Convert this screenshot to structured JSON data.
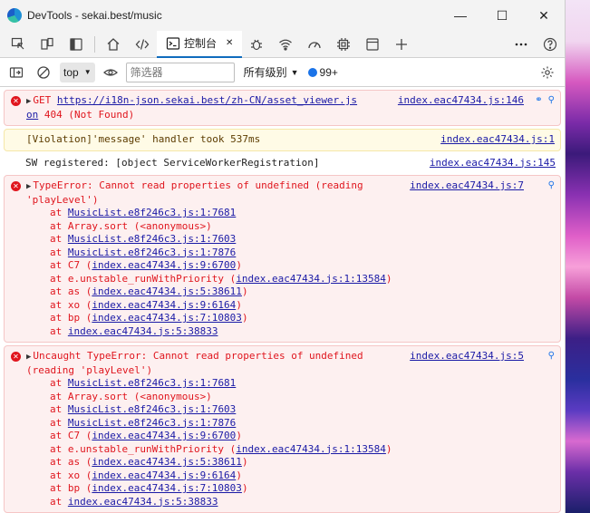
{
  "window": {
    "title": "DevTools - sekai.best/music"
  },
  "toolbar": {
    "console_tab_label": "控制台"
  },
  "filter": {
    "context": "top",
    "placeholder": "筛选器",
    "levels_label": "所有级别",
    "issues_count": "99+"
  },
  "messages": {
    "m1": {
      "text_prefix": "GET ",
      "url": "https://i18n-json.sekai.best/zh-CN/asset_viewer.js",
      "url2": "on",
      "status": " 404 (Not Found)",
      "source": "index.eac47434.js:146"
    },
    "m2": {
      "text": "[Violation]'message' handler took 537ms",
      "source": "index.eac47434.js:1"
    },
    "m3": {
      "text": "SW registered: [object ServiceWorkerRegistration]",
      "source": "index.eac47434.js:145"
    },
    "m4": {
      "text1": "TypeError: Cannot read properties of undefined (reading",
      "text2": "'playLevel')",
      "source": "index.eac47434.js:7"
    },
    "m5": {
      "text1": "Uncaught TypeError: Cannot read properties of undefined",
      "text2": "(reading 'playLevel')",
      "source": "index.eac47434.js:5"
    },
    "frames": [
      {
        "prefix": "at ",
        "link": "MusicList.e8f246c3.js:1:7681",
        "suffix": ""
      },
      {
        "prefix": "at Array.sort (<anonymous>)",
        "link": "",
        "suffix": ""
      },
      {
        "prefix": "at ",
        "link": "MusicList.e8f246c3.js:1:7603",
        "suffix": ""
      },
      {
        "prefix": "at ",
        "link": "MusicList.e8f246c3.js:1:7876",
        "suffix": ""
      },
      {
        "prefix": "at C7 (",
        "link": "index.eac47434.js:9:6700",
        "suffix": ")"
      },
      {
        "prefix": "at e.unstable_runWithPriority (",
        "link": "index.eac47434.js:1:13584",
        "suffix": ")"
      },
      {
        "prefix": "at as (",
        "link": "index.eac47434.js:5:38611",
        "suffix": ")"
      },
      {
        "prefix": "at xo (",
        "link": "index.eac47434.js:9:6164",
        "suffix": ")"
      },
      {
        "prefix": "at bp (",
        "link": "index.eac47434.js:7:10803",
        "suffix": ")"
      },
      {
        "prefix": "at ",
        "link": "index.eac47434.js:5:38833",
        "suffix": ""
      }
    ]
  },
  "colors": {
    "error": "#e0161e",
    "accent": "#0f6cbd",
    "link": "#1a1aa6"
  }
}
